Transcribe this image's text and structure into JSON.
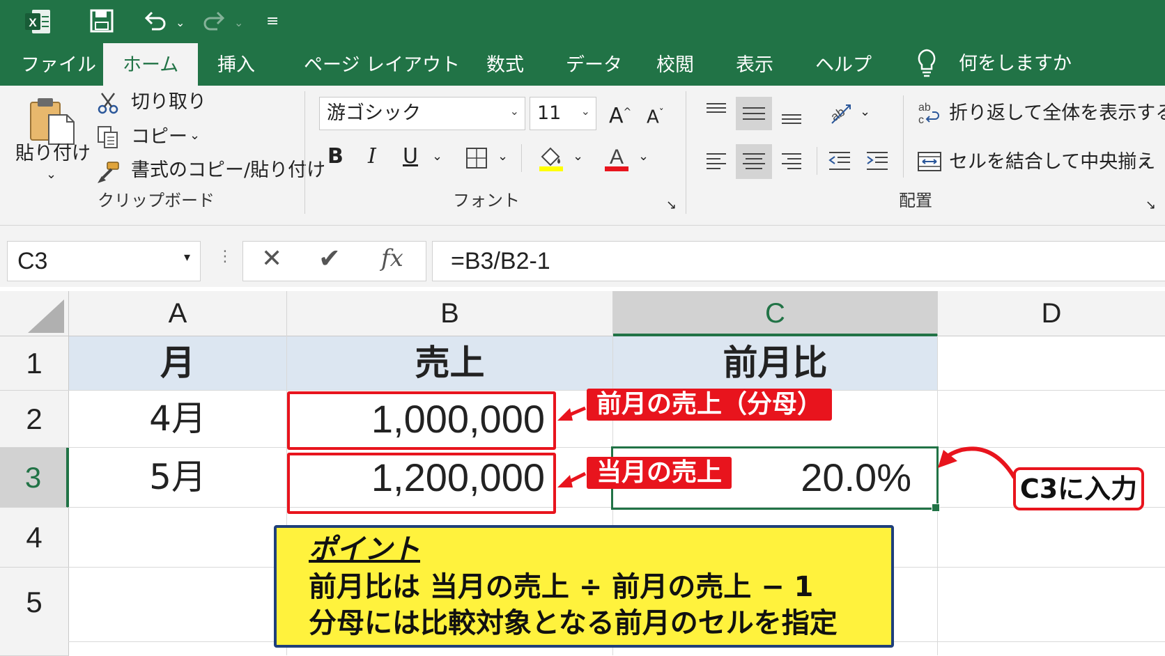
{
  "app": {
    "name": "Excel"
  },
  "tabs": [
    {
      "label": "ファイル",
      "active": false
    },
    {
      "label": "ホーム",
      "active": true
    },
    {
      "label": "挿入",
      "active": false
    },
    {
      "label": "ページ レイアウト",
      "active": false
    },
    {
      "label": "数式",
      "active": false
    },
    {
      "label": "データ",
      "active": false
    },
    {
      "label": "校閲",
      "active": false
    },
    {
      "label": "表示",
      "active": false
    },
    {
      "label": "ヘルプ",
      "active": false
    }
  ],
  "tell_me": {
    "placeholder": "何をしますか",
    "icon": "lightbulb-icon"
  },
  "ribbon": {
    "clipboard": {
      "paste": "貼り付け",
      "cut": "切り取り",
      "copy": "コピー",
      "format_painter": "書式のコピー/貼り付け",
      "group_label": "クリップボード"
    },
    "font": {
      "font_name": "游ゴシック",
      "font_size": "11",
      "bold": "B",
      "italic": "I",
      "underline": "U",
      "font_color_glyph": "A",
      "grow_glyph": "A",
      "shrink_glyph": "A",
      "group_label": "フォント",
      "fill_color": "#ffff00",
      "font_color": "#e8141d"
    },
    "alignment": {
      "wrap_text": "折り返して全体を表示する",
      "merge_center": "セルを結合して中央揃え",
      "group_label": "配置"
    }
  },
  "formula_bar": {
    "name_box": "C3",
    "fx": "fx",
    "formula": "=B3/B2-1"
  },
  "grid": {
    "columns": [
      "A",
      "B",
      "C",
      "D"
    ],
    "rows": [
      "1",
      "2",
      "3",
      "4",
      "5"
    ],
    "selected_column": "C",
    "selected_row": "3",
    "header_row": {
      "A": "月",
      "B": "売上",
      "C": "前月比"
    },
    "row2": {
      "A": "4月",
      "B": "1,000,000"
    },
    "row3": {
      "A": "5月",
      "B": "1,200,000",
      "C": "20.0%"
    }
  },
  "annotations": {
    "prev_month_label": "前月の売上（分母）",
    "this_month_label": "当月の売上",
    "input_label": "C3に入力",
    "point_title": "ポイント",
    "point_line1": "前月比は 当月の売上 ÷ 前月の売上 − 1",
    "point_line2": "分母には比較対象となる前月のセルを指定"
  },
  "colors": {
    "excel_green": "#217346",
    "highlight_red": "#e8141d",
    "point_yellow": "#fff23d",
    "point_border": "#1f3f7a",
    "header_fill": "#dce6f1"
  }
}
